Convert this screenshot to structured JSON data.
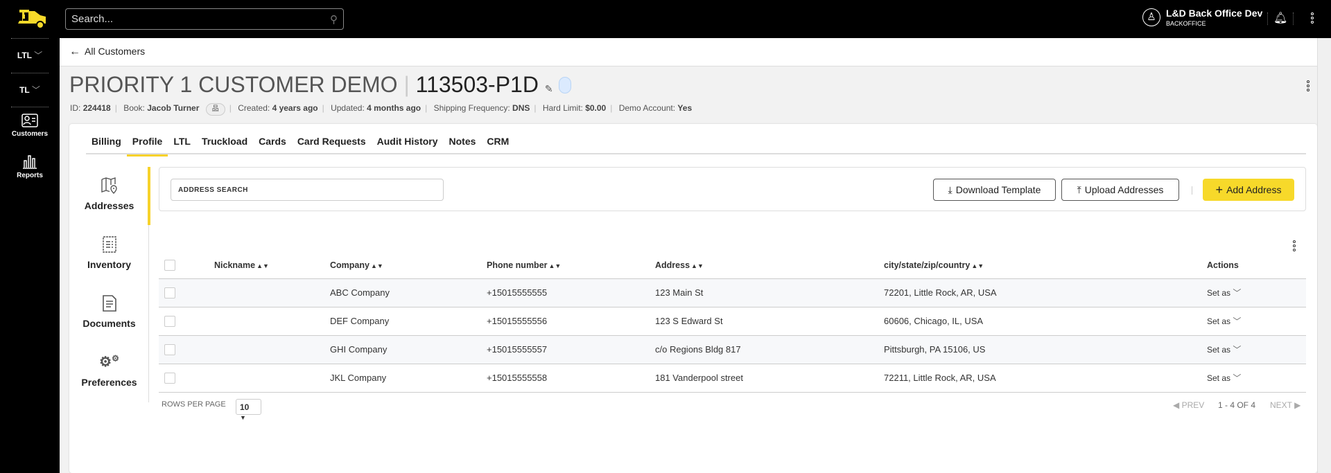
{
  "sidebar": {
    "nav": [
      {
        "label": "LTL"
      },
      {
        "label": "TL"
      }
    ],
    "items": [
      {
        "label": "Customers",
        "icon": "customer-card-icon"
      },
      {
        "label": "Reports",
        "icon": "bar-chart-icon"
      }
    ],
    "brand_color": "#f7d92a"
  },
  "topbar": {
    "search_placeholder": "Search...",
    "user_name": "L&D Back Office Dev",
    "user_role": "BACKOFFICE"
  },
  "breadcrumb": {
    "back_label": "All Customers"
  },
  "customer": {
    "name": "PRIORITY 1 CUSTOMER DEMO",
    "code": "113503-P1D",
    "meta": {
      "id_label": "ID:",
      "id": "224418",
      "book_label": "Book:",
      "book": "Jacob Turner",
      "created_label": "Created:",
      "created": "4 years ago",
      "updated_label": "Updated:",
      "updated": "4 months ago",
      "freq_label": "Shipping Frequency:",
      "freq": "DNS",
      "limit_label": "Hard Limit:",
      "limit": "$0.00",
      "demo_label": "Demo Account:",
      "demo": "Yes"
    }
  },
  "tabs": [
    "Billing",
    "Profile",
    "LTL",
    "Truckload",
    "Cards",
    "Card Requests",
    "Audit History",
    "Notes",
    "CRM"
  ],
  "subnav": [
    "Addresses",
    "Inventory",
    "Documents",
    "Preferences"
  ],
  "toolbar": {
    "search_placeholder": "ADDRESS SEARCH",
    "download": "Download Template",
    "upload": "Upload Addresses",
    "add": "Add Address"
  },
  "table": {
    "headers": [
      "Nickname",
      "Company",
      "Phone number",
      "Address",
      "city/state/zip/country",
      "Actions"
    ],
    "rows": [
      {
        "nickname": "",
        "company": "ABC Company",
        "phone": "+15015555555",
        "address": "123 Main St",
        "city": "72201, Little Rock, AR, USA",
        "action": "Set as"
      },
      {
        "nickname": "",
        "company": "DEF Company",
        "phone": "+15015555556",
        "address": "123 S Edward St",
        "city": "60606, Chicago, IL, USA",
        "action": "Set as"
      },
      {
        "nickname": "",
        "company": "GHI Company",
        "phone": "+15015555557",
        "address": "c/o Regions Bldg 817",
        "city": "Pittsburgh, PA 15106, US",
        "action": "Set as"
      },
      {
        "nickname": "",
        "company": "JKL Company",
        "phone": "+15015555558",
        "address": "181 Vanderpool street",
        "city": "72211, Little Rock, AR, USA",
        "action": "Set as"
      }
    ]
  },
  "pagination": {
    "rows_label": "ROWS PER PAGE",
    "rows_value": "10",
    "prev": "PREV",
    "range": "1 - 4 OF 4",
    "next": "NEXT"
  }
}
